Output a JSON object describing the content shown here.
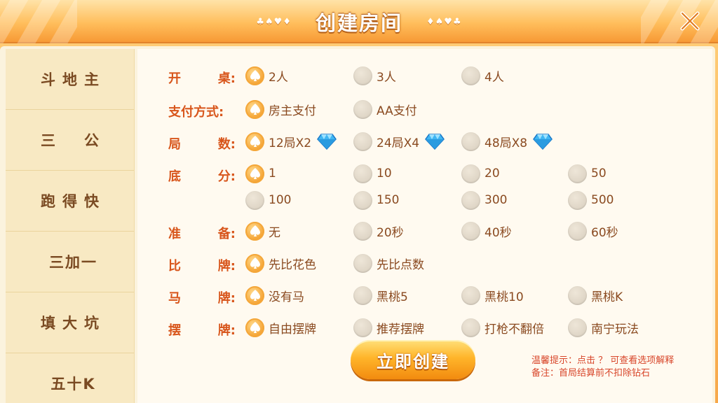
{
  "header": {
    "title": "创建房间",
    "deco_left": "♣♠♥♦",
    "deco_right": "♦♠♥♣"
  },
  "sidebar": {
    "items": [
      "斗地主",
      "三　公",
      "跑得快",
      "三加一",
      "填大坑",
      "五十K"
    ]
  },
  "rows": {
    "table": {
      "label_a": "开",
      "label_b": "桌:",
      "options": [
        "2人",
        "3人",
        "4人"
      ],
      "selected": 0
    },
    "payment": {
      "label": "支付方式:",
      "options": [
        "房主支付",
        "AA支付"
      ],
      "selected": 0
    },
    "rounds": {
      "label_a": "局",
      "label_b": "数:",
      "options": [
        "12局X2",
        "24局X4",
        "48局X8"
      ],
      "selected": 0
    },
    "base": {
      "label_a": "底",
      "label_b": "分:",
      "options": [
        "1",
        "10",
        "20",
        "50",
        "100",
        "150",
        "300",
        "500"
      ],
      "selected": 0
    },
    "ready": {
      "label_a": "准",
      "label_b": "备:",
      "options": [
        "无",
        "20秒",
        "40秒",
        "60秒"
      ],
      "selected": 0
    },
    "compare": {
      "label_a": "比",
      "label_b": "牌:",
      "options": [
        "先比花色",
        "先比点数"
      ],
      "selected": 0
    },
    "horse": {
      "label_a": "马",
      "label_b": "牌:",
      "options": [
        "没有马",
        "黑桃5",
        "黑桃10",
        "黑桃K"
      ],
      "selected": 0
    },
    "arrange": {
      "label_a": "摆",
      "label_b": "牌:",
      "options": [
        "自由摆牌",
        "推荐摆牌",
        "打枪不翻倍",
        "南宁玩法"
      ],
      "selected": 0
    }
  },
  "create_button": "立即创建",
  "hints": {
    "line1": "温馨提示：点击 ？  可查看选项解释",
    "line2": "备注：首局结算前不扣除钻石"
  },
  "colors": {
    "accent": "#f39a25",
    "label": "#d8561c",
    "text": "#8a4a20",
    "panel": "#fffaf0"
  }
}
